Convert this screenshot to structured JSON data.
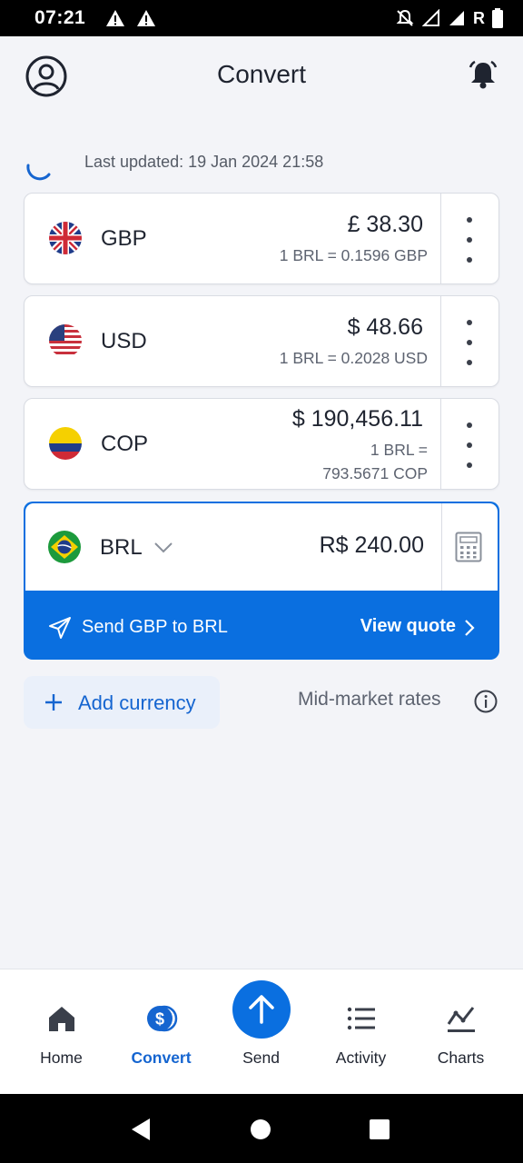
{
  "status_bar": {
    "time": "07:21",
    "carrier_letter": "R"
  },
  "header": {
    "title": "Convert"
  },
  "last_updated": "Last updated: 19 Jan 2024 21:58",
  "currencies": [
    {
      "code": "GBP",
      "amount": "£ 38.30",
      "rate": "1 BRL = 0.1596 GBP",
      "flag": "uk-flag"
    },
    {
      "code": "USD",
      "amount": "$ 48.66",
      "rate": "1 BRL = 0.2028 USD",
      "flag": "us-flag"
    },
    {
      "code": "COP",
      "amount": "$ 190,456.11",
      "rate_line1": "1 BRL =",
      "rate_line2": "793.5671 COP",
      "flag": "colombia-flag"
    }
  ],
  "base_currency": {
    "code": "BRL",
    "amount": "R$ 240.00",
    "flag": "brazil-flag"
  },
  "send_bar": {
    "label": "Send GBP to BRL",
    "quote": "View quote"
  },
  "add_currency": "Add currency",
  "mid_market": "Mid-market rates",
  "nav": [
    {
      "label": "Home",
      "icon": "home-icon"
    },
    {
      "label": "Convert",
      "icon": "convert-icon",
      "active": true
    },
    {
      "label": "Send",
      "icon": "send-icon"
    },
    {
      "label": "Activity",
      "icon": "activity-icon"
    },
    {
      "label": "Charts",
      "icon": "charts-icon"
    }
  ],
  "colors": {
    "accent": "#0a6fe0",
    "link": "#1565d0",
    "background": "#f3f4f8"
  }
}
